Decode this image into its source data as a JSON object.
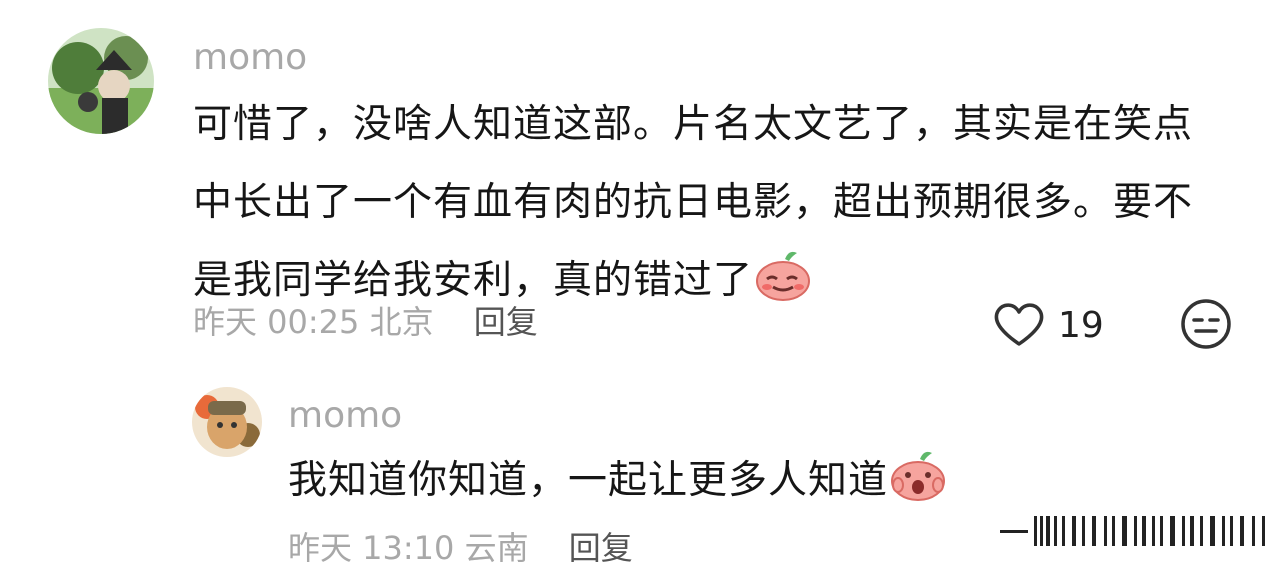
{
  "comments": [
    {
      "username": "momo",
      "lines": [
        "可惜了，没啥人知道这部。片名太文艺了，其实是在笑点",
        "中长出了一个有血有肉的抗日电影，超出预期很多。要不",
        "是我同学给我安利，真的错过了"
      ],
      "emoji": "blush-face-emoji",
      "time": "昨天 00:25",
      "location": "北京",
      "reply_label": "回复",
      "like_count": "19",
      "icons": {
        "like": "heart-icon",
        "react": "meh-face-icon"
      }
    }
  ],
  "replies": [
    {
      "username": "momo",
      "text": "我知道你知道，一起让更多人知道",
      "emoji": "shocked-face-emoji",
      "time": "昨天 13:10",
      "location": "云南",
      "reply_label": "回复"
    }
  ],
  "colors": {
    "meta": "#a8a8a8",
    "text": "#161616",
    "emoji": "#f28a84"
  }
}
